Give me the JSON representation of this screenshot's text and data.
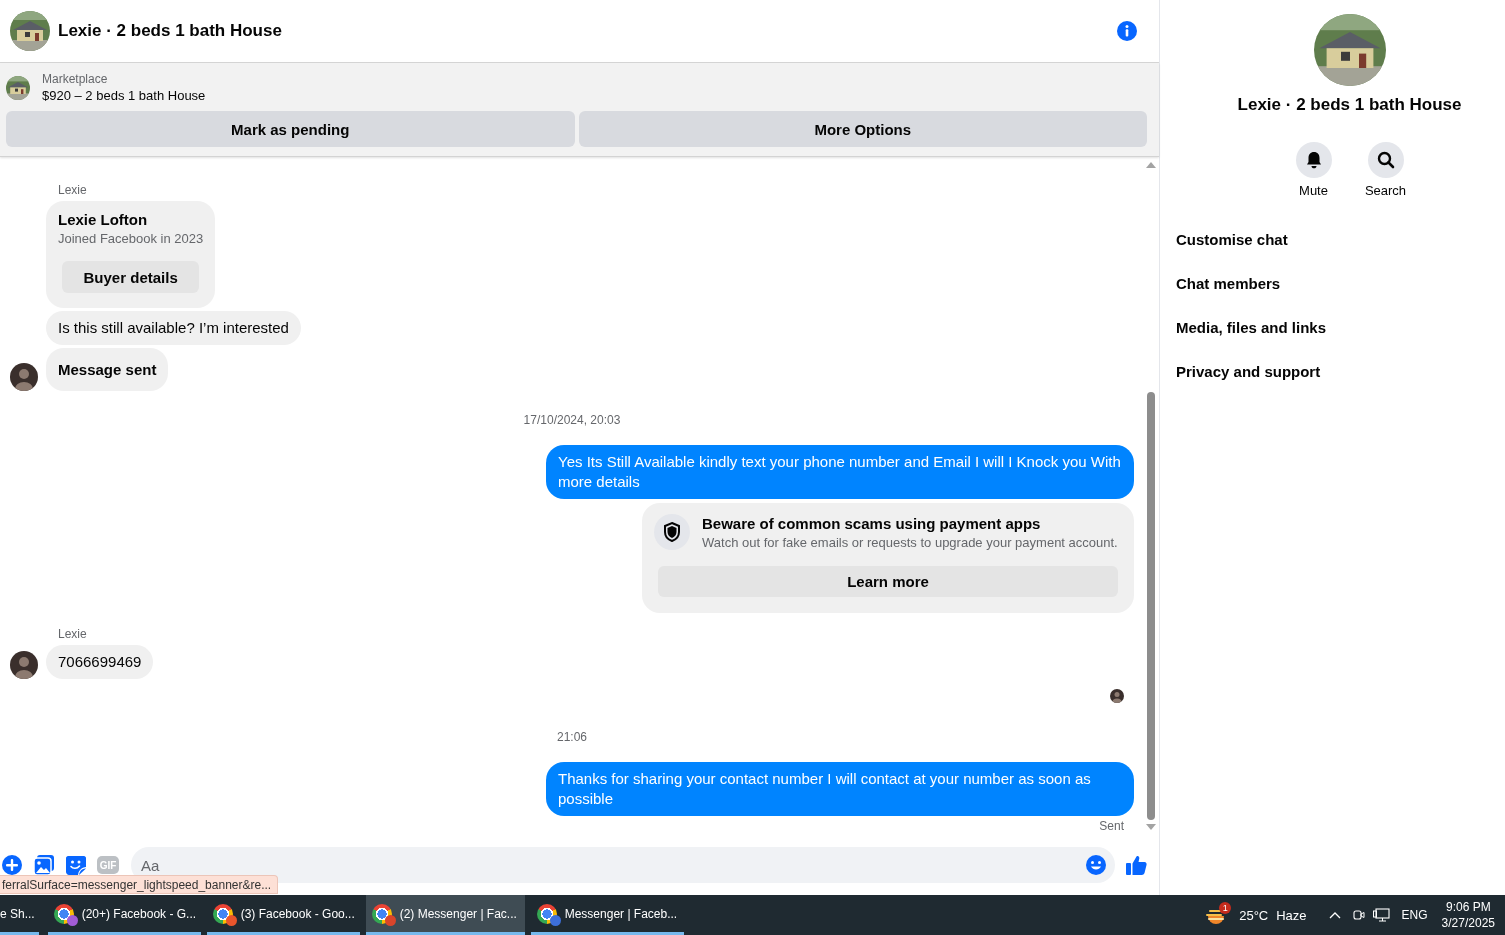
{
  "header": {
    "title": "Lexie · 2 beds 1 bath House"
  },
  "listing": {
    "source": "Marketplace",
    "summary": "$920 – 2 beds 1 bath House",
    "actions": [
      "Mark as pending",
      "More Options"
    ]
  },
  "messages": [
    {
      "kind": "sender",
      "text": "Lexie"
    },
    {
      "kind": "card",
      "title": "Lexie Lofton",
      "subtitle": "Joined Facebook in 2023",
      "button": "Buyer details"
    },
    {
      "kind": "incoming",
      "text": "Is this still available? I’m interested",
      "avatar": false,
      "emphasis": false
    },
    {
      "kind": "incoming",
      "text": "Message sent",
      "avatar": true,
      "emphasis": true
    },
    {
      "kind": "timestamp",
      "text": "17/10/2024, 20:03"
    },
    {
      "kind": "outgoing",
      "text": "Yes Its Still Available kindly text your phone number and Email I will I Knock you With more details"
    },
    {
      "kind": "notice",
      "title": "Beware of common scams using payment apps",
      "body": "Watch out for fake emails or requests to upgrade your payment account.",
      "button": "Learn more"
    },
    {
      "kind": "sender",
      "text": "Lexie"
    },
    {
      "kind": "incoming",
      "text": "7066699469",
      "avatar": true,
      "emphasis": false
    },
    {
      "kind": "seen"
    },
    {
      "kind": "timestamp",
      "text": "21:06"
    },
    {
      "kind": "outgoing",
      "text": "Thanks for sharing your contact number I will contact at your number as soon as possible"
    },
    {
      "kind": "status",
      "text": "Sent"
    }
  ],
  "composer": {
    "gif_label": "GIF",
    "placeholder": "Aa"
  },
  "link_preview": "ferralSurface=messenger_lightspeed_banner&re...",
  "details_panel": {
    "title": "Lexie · 2 beds 1 bath House",
    "actions": [
      {
        "kind": "mute",
        "label": "Mute"
      },
      {
        "kind": "search",
        "label": "Search"
      }
    ],
    "menu": [
      "Customise chat",
      "Chat members",
      "Media, files and links",
      "Privacy and support"
    ]
  },
  "taskbar": {
    "apps": [
      {
        "label": "e Sh...",
        "selected": false
      },
      {
        "label": "(20+) Facebook - G...",
        "selected": false,
        "color": "#a25cd6"
      },
      {
        "label": "(3) Facebook - Goo...",
        "selected": false,
        "color": "#e8552c"
      },
      {
        "label": "(2) Messenger | Fac...",
        "selected": true,
        "color": "#d9452b"
      },
      {
        "label": "Messenger | Faceb...",
        "selected": false,
        "color": "#3d6fd9"
      }
    ],
    "weather": {
      "badge": "1",
      "temperature": "25°C",
      "condition": "Haze"
    },
    "language": "ENG",
    "time": "9:06 PM",
    "date": "3/27/2025"
  }
}
